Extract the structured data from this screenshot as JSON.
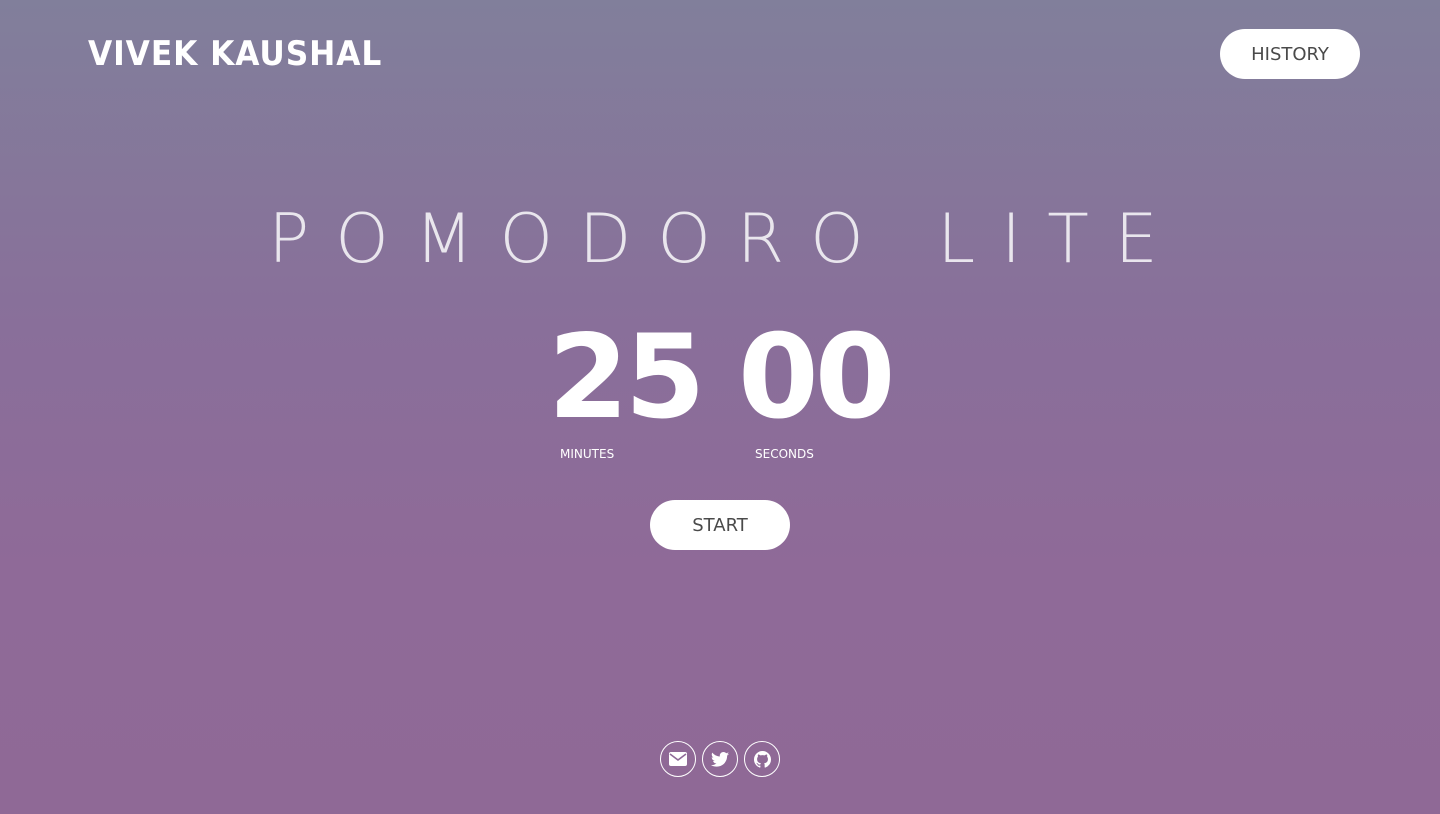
{
  "header": {
    "brand": "VIVEK KAUSHAL",
    "history_label": "HISTORY"
  },
  "main": {
    "title": "POMODORO LITE",
    "timer": {
      "minutes": "25",
      "seconds": "00",
      "minutes_label": "MINUTES",
      "seconds_label": "SECONDS"
    },
    "start_label": "START"
  },
  "footer": {
    "social_icons": [
      "envelope-icon",
      "twitter-icon",
      "github-icon"
    ]
  },
  "colors": {
    "background_top": "#817f9b",
    "background_bottom": "#8f6996",
    "button_bg": "#ffffff",
    "button_text": "#4a4a4a"
  }
}
